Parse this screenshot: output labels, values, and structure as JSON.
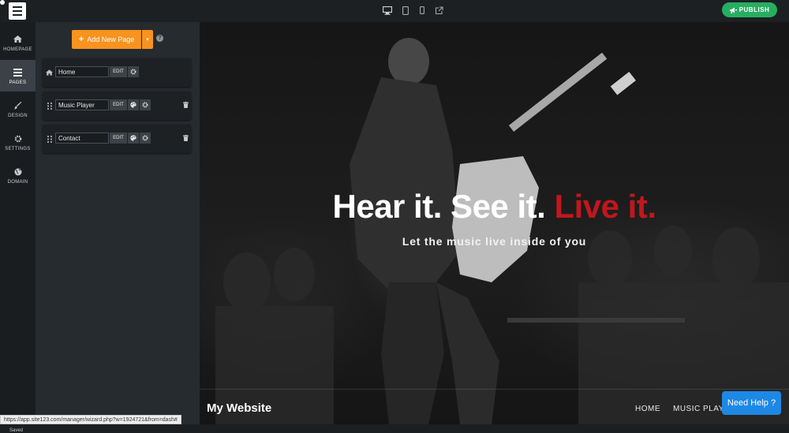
{
  "toolbar": {
    "logo_icon": "hamburger-logo-icon",
    "devices": [
      "desktop-icon",
      "tablet-icon",
      "mobile-icon",
      "external-link-icon"
    ],
    "publish_label": "PUBLISH",
    "publish_color": "#27ae60"
  },
  "sidebar": {
    "items": [
      {
        "label": "HOMEPAGE",
        "icon": "home-icon"
      },
      {
        "label": "PAGES",
        "icon": "pages-icon",
        "active": true
      },
      {
        "label": "DESIGN",
        "icon": "brush-icon"
      },
      {
        "label": "SETTINGS",
        "icon": "gear-icon"
      },
      {
        "label": "DOMAIN",
        "icon": "globe-icon"
      }
    ],
    "status": "Saved"
  },
  "pages_panel": {
    "add_label": "Add New Page",
    "accent": "#f7931e",
    "pages": [
      {
        "name": "Home",
        "edit": "EDIT"
      },
      {
        "name": "Music Player",
        "edit": "EDIT"
      },
      {
        "name": "Contact",
        "edit": "EDIT"
      }
    ]
  },
  "preview": {
    "hero_title_a": "Hear it. See it.",
    "hero_title_b": "Live it.",
    "hero_title_b_color": "#c0171c",
    "hero_subtitle": "Let the music live inside of you",
    "site_name": "My Website",
    "nav": [
      "HOME",
      "MUSIC PLAYER"
    ]
  },
  "help_button": "Need Help ?",
  "status_url": "https://app.site123.com/manager/wizard.php?w=1924721&from=dash#"
}
